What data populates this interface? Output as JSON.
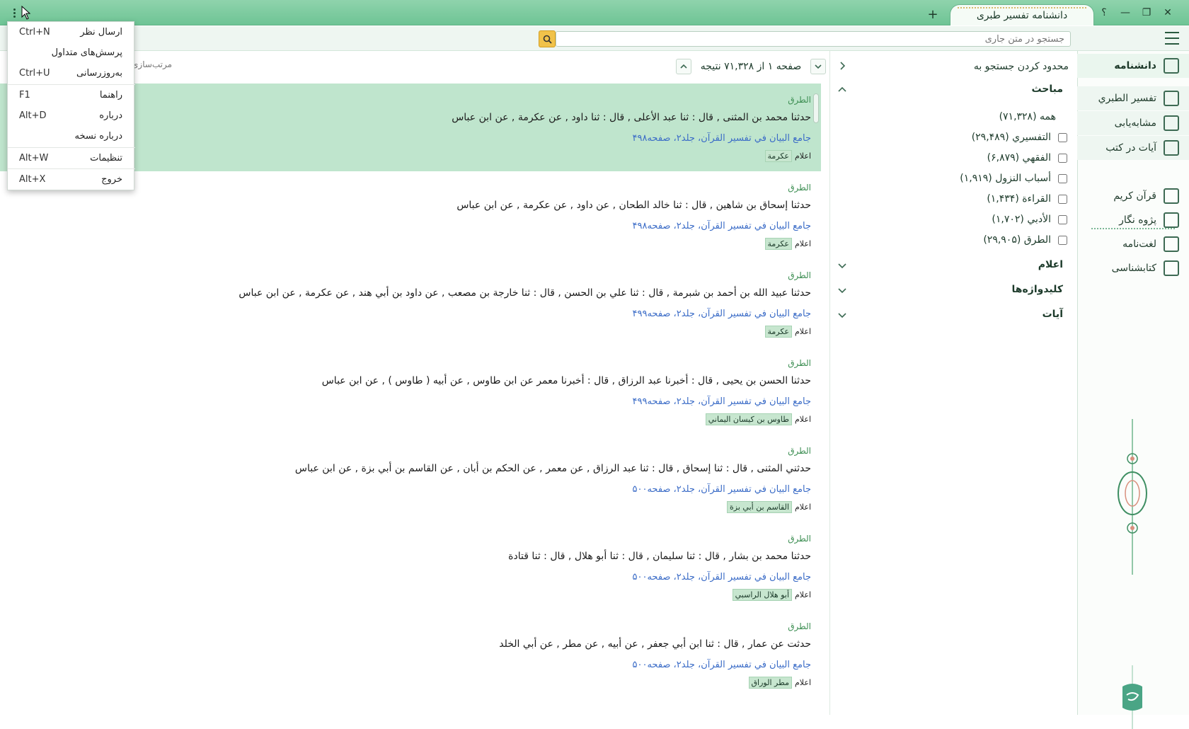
{
  "titlebar": {
    "tab_title": "دانشنامه تفسیر طبری",
    "add_tab": "+",
    "help": "؟",
    "minimize": "—",
    "restore": "❐",
    "close": "✕"
  },
  "toolbar": {
    "search_placeholder": "جستجو در متن جاری"
  },
  "menu": {
    "items": [
      {
        "label": "ارسال نظر",
        "shortcut": "Ctrl+N"
      },
      {
        "label": "پرسش‌های متداول",
        "shortcut": ""
      },
      {
        "label": "به‌روزرسانی",
        "shortcut": "Ctrl+U"
      },
      {
        "label": "راهنما",
        "shortcut": "F1"
      },
      {
        "label": "درباره",
        "shortcut": "Alt+D"
      },
      {
        "label": "درباره نسخه",
        "shortcut": ""
      },
      {
        "label": "تنظیمات",
        "shortcut": "Alt+W"
      },
      {
        "label": "خروج",
        "shortcut": "Alt+X"
      }
    ]
  },
  "sidebar": {
    "active": "دانشنامه",
    "sub_items": [
      "تفسیر الطبري",
      "مشابه‌یابی",
      "آیات در کتب"
    ],
    "items": [
      "قرآن کریم",
      "پژوه نگار",
      "لغت‌نامه",
      "کتابشناسی"
    ]
  },
  "facets": {
    "header": "محدود کردن جستجو به",
    "sections": {
      "mabahes": "مباحث",
      "alam": "اعلام",
      "keywords": "کلیدواژه‌ها",
      "ayat": "آیات"
    },
    "all": "همه (۷۱,۳۲۸)",
    "options": [
      "التفسيري (۲۹,۴۸۹)",
      "الفقهي (۶,۸۷۹)",
      "أسباب النزول (۱,۹۱۹)",
      "القراءة (۱,۴۳۴)",
      "الأدبي (۱,۷۰۲)",
      "الطرق (۲۹,۹۰۵)"
    ]
  },
  "results_header": {
    "page_info": "صفحه ۱ از ۷۱,۳۲۸ نتیجه",
    "sort_label": "مرتب‌سازی"
  },
  "results": [
    {
      "category": "الطرق",
      "text": "حدثنا محمد بن المثنى , قال : ثنا عبد الأعلى , قال : ثنا داود , عن عكرمة , عن ابن عباس",
      "source": "جامع البيان في تفسير القرآن، جلد۲، صفحه۴۹۸",
      "tag_label": "اعلام",
      "tag": "عكرمة"
    },
    {
      "category": "الطرق",
      "text": "حدثنا إسحاق بن شاهين , قال : ثنا خالد الطحان , عن داود , عن عكرمة , عن ابن عباس",
      "source": "جامع البيان في تفسير القرآن، جلد۲، صفحه۴۹۸",
      "tag_label": "اعلام",
      "tag": "عكرمة"
    },
    {
      "category": "الطرق",
      "text": "حدثنا عبيد الله بن أحمد بن شبرمة , قال : ثنا علي بن الحسن , قال : ثنا خارجة بن مصعب , عن داود بن أبي هند , عن عكرمة , عن ابن عباس",
      "source": "جامع البيان في تفسير القرآن، جلد۲، صفحه۴۹۹",
      "tag_label": "اعلام",
      "tag": "عكرمة"
    },
    {
      "category": "الطرق",
      "text": "حدثنا الحسن بن يحيى , قال : أخبرنا عبد الرزاق , قال : أخبرنا معمر عن ابن طاوس , عن أبيه ( طاوس ) , عن ابن عباس",
      "source": "جامع البيان في تفسير القرآن، جلد۲، صفحه۴۹۹",
      "tag_label": "اعلام",
      "tag": "طاوس بن كيسان اليماني"
    },
    {
      "category": "الطرق",
      "text": "حدثني المثنى , قال : ثنا إسحاق , قال : ثنا عبد الرزاق , عن معمر , عن الحكم بن أبان , عن القاسم بن أبي بزة , عن ابن عباس",
      "source": "جامع البيان في تفسير القرآن، جلد۲، صفحه۵۰۰",
      "tag_label": "اعلام",
      "tag": "القاسم بن أبي بزة"
    },
    {
      "category": "الطرق",
      "text": "حدثنا محمد بن بشار , قال : ثنا سليمان , قال : ثنا أبو هلال , قال : ثنا قتادة",
      "source": "جامع البيان في تفسير القرآن، جلد۲، صفحه۵۰۰",
      "tag_label": "اعلام",
      "tag": "أبو هلال الراسبي"
    },
    {
      "category": "الطرق",
      "text": "حدثت عن عمار , قال : ثنا ابن أبي جعفر , عن أبيه , عن مطر , عن أبي الخلد",
      "source": "جامع البيان في تفسير القرآن، جلد۲، صفحه۵۰۰",
      "tag_label": "اعلام",
      "tag": "مطر الوراق"
    }
  ]
}
